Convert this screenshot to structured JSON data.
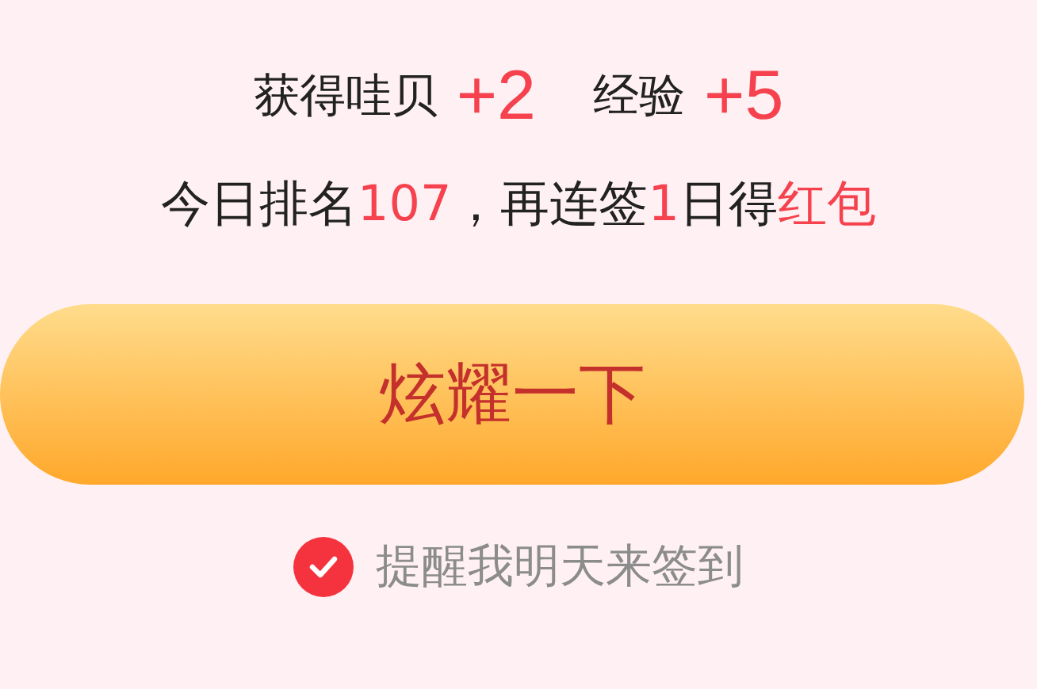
{
  "rewards": [
    {
      "label": "获得哇贝",
      "value": "+2"
    },
    {
      "label": "经验",
      "value": "+5"
    }
  ],
  "rank_line": [
    {
      "text": "今日排名",
      "highlight": false
    },
    {
      "text": "107",
      "highlight": true
    },
    {
      "text": "，再连签",
      "highlight": false
    },
    {
      "text": "1",
      "highlight": true
    },
    {
      "text": "日得",
      "highlight": false
    },
    {
      "text": "红包",
      "highlight": true
    }
  ],
  "share_button": {
    "label": "炫耀一下"
  },
  "reminder": {
    "label": "提醒我明天来签到",
    "checked": true
  }
}
